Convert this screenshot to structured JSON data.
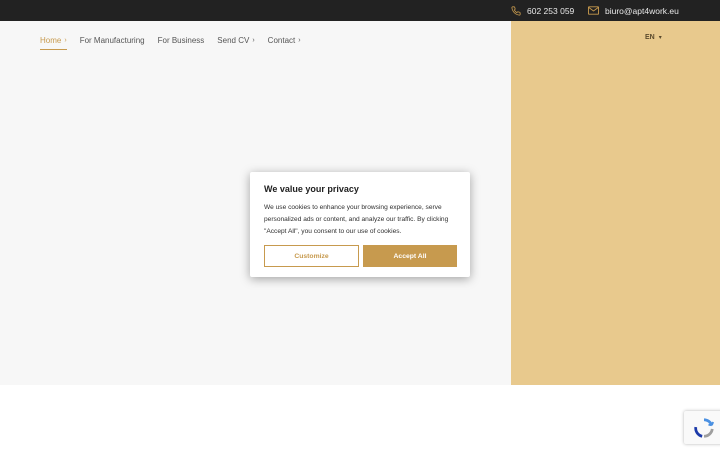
{
  "topbar": {
    "phone": "602 253 059",
    "email": "biuro@apt4work.eu"
  },
  "nav": {
    "items": [
      {
        "label": "Home",
        "active": true
      },
      {
        "label": "For Manufacturing"
      },
      {
        "label": "For Business"
      },
      {
        "label": "Send CV"
      },
      {
        "label": "Contact"
      }
    ],
    "language": "EN"
  },
  "cookie_modal": {
    "title": "We value your privacy",
    "text": "We use cookies to enhance your browsing experience, serve personalized ads or content, and analyze our traffic. By clicking \"Accept All\", you consent to our use of cookies.",
    "customize_label": "Customize",
    "accept_label": "Accept All"
  },
  "colors": {
    "accent": "#c79a4e",
    "hero_right": "#e8c98d",
    "topbar": "#222222"
  },
  "icons": [
    "phone-icon",
    "mail-icon",
    "chevron-right-icon",
    "caret-down-icon",
    "recaptcha-icon"
  ]
}
